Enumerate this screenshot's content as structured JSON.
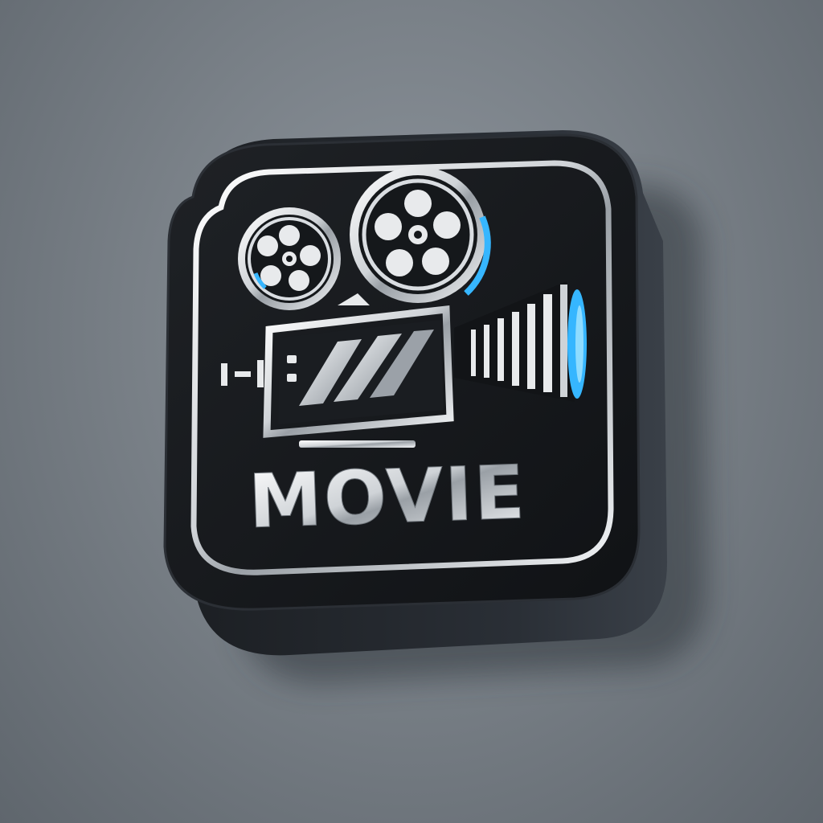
{
  "app_icon": {
    "label": "MOVIE",
    "icon": "movie-projector-icon",
    "colors": {
      "background": "#7a8188",
      "tile": "#16181c",
      "tile_side": "#24282e",
      "chrome": "#e6e8ea",
      "accent": "#36b6ff"
    }
  }
}
